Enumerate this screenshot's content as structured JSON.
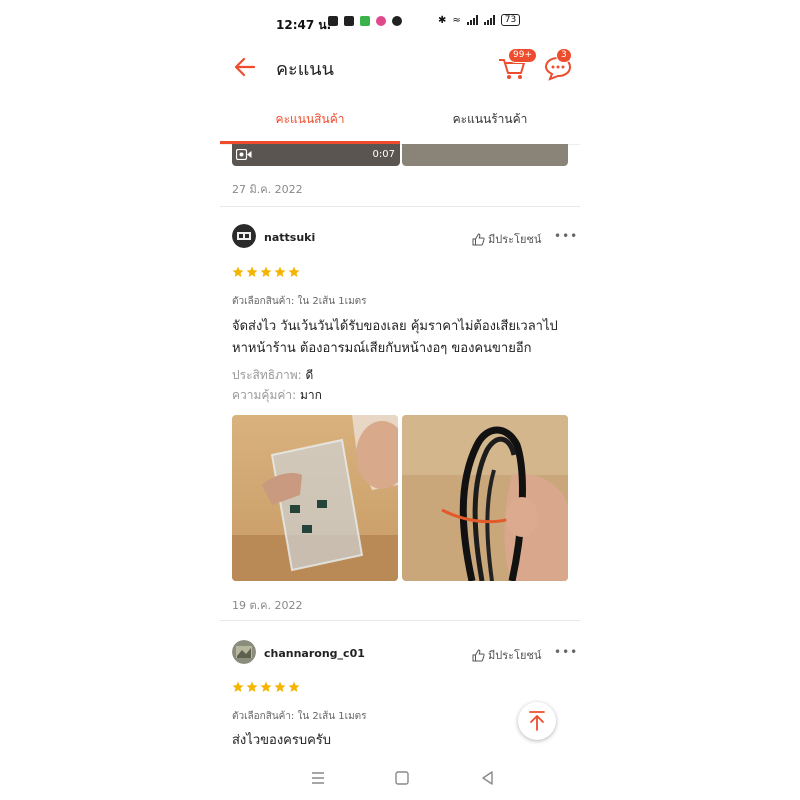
{
  "status_bar": {
    "time": "12:47 น.",
    "battery": "73"
  },
  "header": {
    "title": "คะแนน",
    "cart_badge": "99+",
    "chat_badge": "3"
  },
  "tabs": [
    {
      "label": "คะแนนสินค้า",
      "active": true
    },
    {
      "label": "คะแนนร้านค้า",
      "active": false
    }
  ],
  "top_partial": {
    "video_duration": "0:07",
    "date": "27 มิ.ค. 2022"
  },
  "reviews": [
    {
      "username": "nattsuki",
      "helpful_label": "มีประโยชน์",
      "more_label": "•••",
      "stars": 5,
      "variant": "ตัวเลือกสินค้า: ใน 2เส้น 1เมตร",
      "text_line1": "จัดส่งไว วันเว้นวันได้รับของเลย คุ้มราคาไม่ต้องเสียเวลาไป",
      "text_line2": "หาหน้าร้าน ต้องอารมณ์เสียกับหน้างอๆ ของคนขายอีก",
      "attr1_label": "ประสิทธิภาพ:",
      "attr1_value": "ดี",
      "attr2_label": "ความคุ้มค่า:",
      "attr2_value": "มาก",
      "date": "19 ต.ค. 2022"
    },
    {
      "username": "channarong_c01",
      "helpful_label": "มีประโยชน์",
      "more_label": "•••",
      "stars": 5,
      "variant": "ตัวเลือกสินค้า: ใน 2เส้น 1เมตร",
      "text_line1": "ส่งไวของครบครับ"
    }
  ],
  "colors": {
    "accent": "#ee4d2d",
    "star": "#f5b400"
  },
  "icons": [
    "back-arrow-icon",
    "cart-icon",
    "chat-icon",
    "thumbs-up-icon",
    "video-camera-icon",
    "arrow-up-icon",
    "menu-icon",
    "home-square-icon",
    "back-triangle-icon"
  ]
}
